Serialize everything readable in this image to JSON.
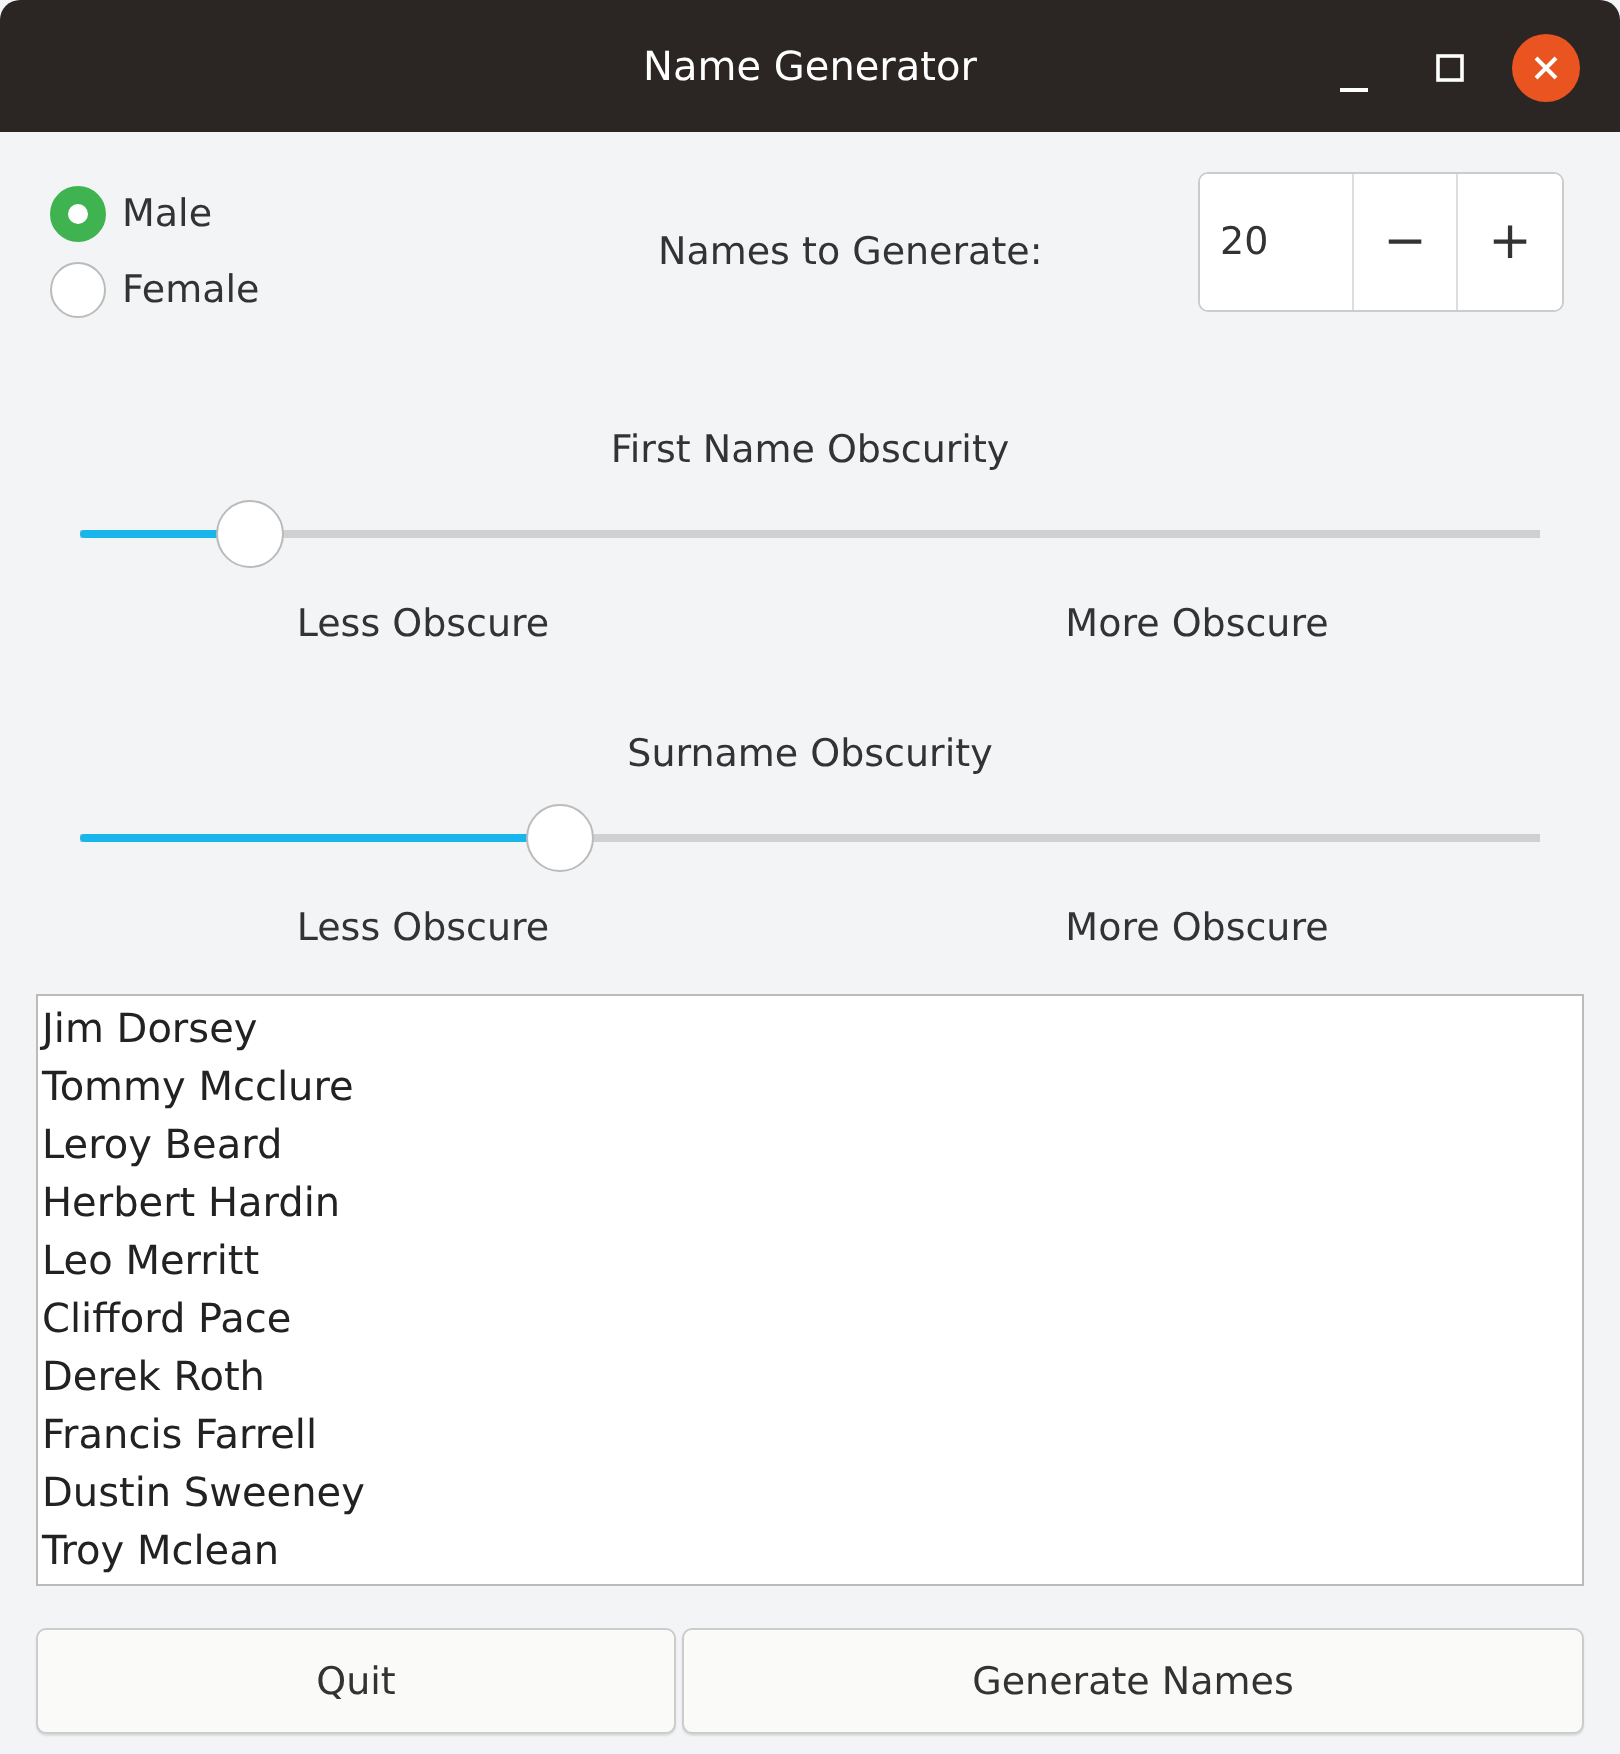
{
  "window": {
    "title": "Name Generator"
  },
  "gender": [
    {
      "label": "Male",
      "selected": true
    },
    {
      "label": "Female",
      "selected": false
    }
  ],
  "count": {
    "label": "Names to Generate:",
    "value": "20",
    "minus": "−",
    "plus": "+"
  },
  "sliders": [
    {
      "title": "First Name Obscurity",
      "level": 0.116,
      "min_label": "Less Obscure",
      "max_label": "More Obscure"
    },
    {
      "title": "Surname Obscurity",
      "level": 0.329,
      "min_label": "Less Obscure",
      "max_label": "More Obscure"
    }
  ],
  "names": [
    "Jim Dorsey",
    "Tommy Mcclure",
    "Leroy Beard",
    "Herbert Hardin",
    "Leo Merritt",
    "Clifford Pace",
    "Derek Roth",
    "Francis Farrell",
    "Dustin Sweeney",
    "Troy Mclean"
  ],
  "buttons": [
    "Quit",
    "Generate Names"
  ]
}
